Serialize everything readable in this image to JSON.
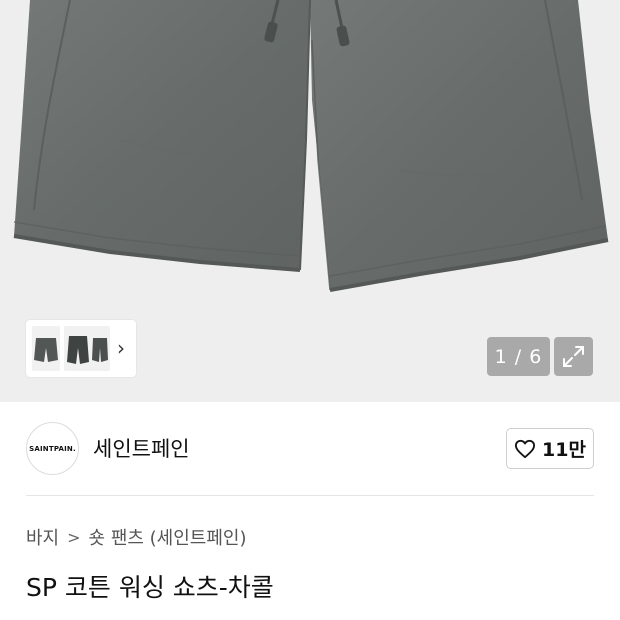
{
  "gallery": {
    "current": "1 / 6",
    "thumbnail_more_icon": "chevron-right-icon",
    "expand_icon": "expand-icon"
  },
  "brand": {
    "logo_text": "SAINTPAIN.",
    "name": "세인트페인"
  },
  "like": {
    "icon": "heart-outline-icon",
    "count": "11만"
  },
  "breadcrumb": {
    "items": [
      "바지",
      "숏 팬츠 (세인트페인)"
    ],
    "separator": ">"
  },
  "product": {
    "title": "SP 코튼 워싱 쇼츠-차콜"
  },
  "colors": {
    "hero_bg": "#eeeeef",
    "garment": "#6b706e",
    "overlay_button": "#a9a9a9"
  }
}
